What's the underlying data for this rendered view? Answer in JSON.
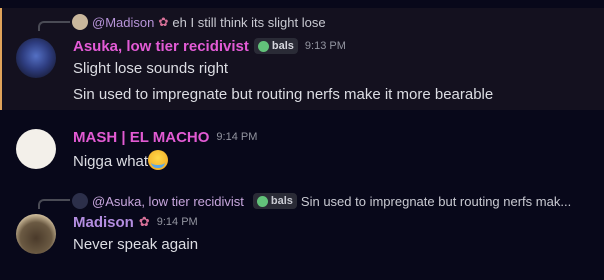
{
  "messages": [
    {
      "reply": {
        "name": "@Madison",
        "text": "eh I still think its slight lose"
      },
      "author": "Asuka, low tier recidivist",
      "tag": "bals",
      "time": "9:13 PM",
      "lines": [
        "Slight lose sounds right",
        "Sin used to impregnate but routing nerfs make it more bearable"
      ]
    },
    {
      "author": "MASH | EL MACHO",
      "time": "9:14 PM",
      "lines": [
        "Nigga what"
      ],
      "emoji": "loudly-crying-face"
    },
    {
      "reply": {
        "name": "@Asuka, low tier recidivist",
        "tag": "bals",
        "text": "Sin used to impregnate but routing nerfs mak..."
      },
      "author": "Madison",
      "time": "9:14 PM",
      "lines": [
        "Never speak again"
      ]
    }
  ],
  "colors": {
    "background": "#08081a",
    "highlight_bar": "#e0a35a",
    "asuka": "#e35bd6",
    "mash": "#e25ad3",
    "madison": "#b38de0"
  }
}
